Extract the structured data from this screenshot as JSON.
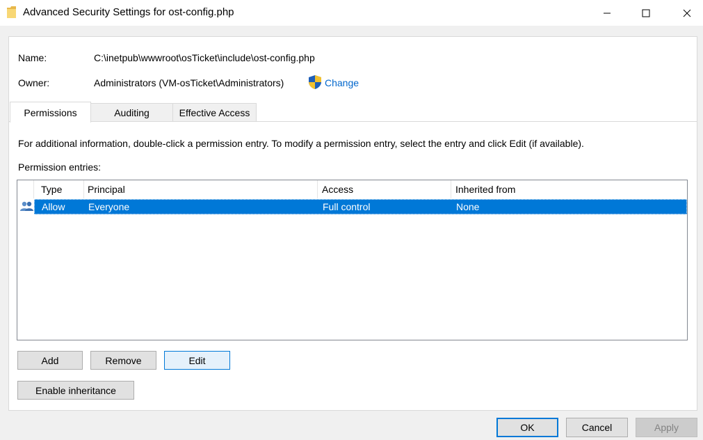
{
  "window": {
    "title": "Advanced Security Settings for ost-config.php",
    "icon": "folder-icon",
    "controls": [
      "minimize-icon",
      "maximize-icon",
      "close-icon"
    ]
  },
  "object": {
    "name_label": "Name:",
    "name_value": "C:\\inetpub\\wwwroot\\osTicket\\include\\ost-config.php",
    "owner_label": "Owner:",
    "owner_value": "Administrators (VM-osTicket\\Administrators)",
    "change_link": "Change",
    "change_icon": "uac-shield-icon"
  },
  "tabs": [
    {
      "label": "Permissions",
      "active": true
    },
    {
      "label": "Auditing",
      "active": false
    },
    {
      "label": "Effective Access",
      "active": false
    }
  ],
  "permissions": {
    "info_text": "For additional information, double-click a permission entry. To modify a permission entry, select the entry and click Edit (if available).",
    "entries_label": "Permission entries:",
    "columns": [
      "Type",
      "Principal",
      "Access",
      "Inherited from"
    ],
    "rows": [
      {
        "icon": "user-group-icon",
        "type": "Allow",
        "principal": "Everyone",
        "access": "Full control",
        "inherited_from": "None",
        "selected": true
      }
    ]
  },
  "buttons": {
    "add": "Add",
    "remove": "Remove",
    "edit": "Edit",
    "enable_inheritance": "Enable inheritance",
    "ok": "OK",
    "cancel": "Cancel",
    "apply": "Apply"
  },
  "colors": {
    "selection": "#0078d7",
    "link": "#0066cc",
    "window_bg": "#f0f0f0"
  }
}
